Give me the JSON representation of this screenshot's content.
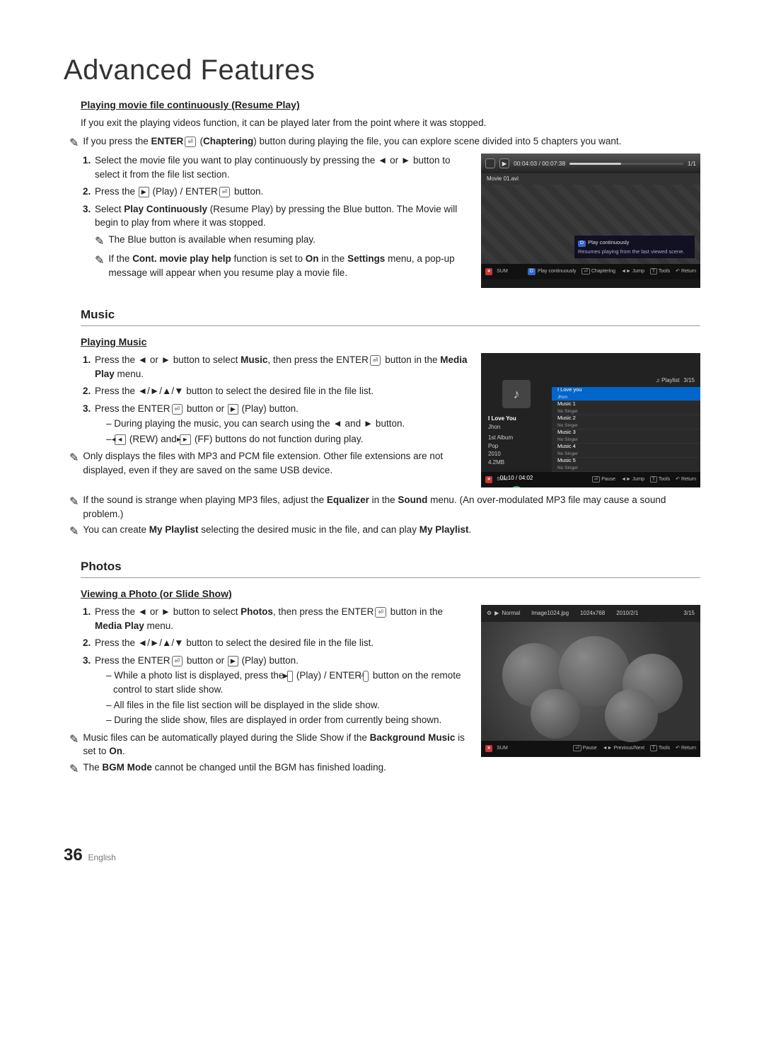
{
  "page": {
    "title": "Advanced Features",
    "number": "36",
    "language": "English"
  },
  "movie_section": {
    "sub_heading": "Playing movie file continuously (Resume Play)",
    "intro": "If you exit the playing videos function, it can be played later from the point where it was stopped.",
    "note_enter_a": "If you press the ",
    "note_enter_b": "ENTER",
    "note_enter_c": " (",
    "note_enter_d": "Chaptering",
    "note_enter_e": ") button during playing the file, you can explore scene divided into 5 chapters you want.",
    "step1": "Select the movie file you want to play continuously by pressing the ◄ or ► button to select it from the file list section.",
    "step2_a": "Press the ",
    "step2_b": " (Play) / ENTER",
    "step2_c": " button.",
    "step3_a": "Select ",
    "step3_b": "Play Continuously",
    "step3_c": " (Resume Play) by pressing the Blue button. The Movie will begin to play from where it was stopped.",
    "note_blue": "The Blue button is available when resuming play.",
    "note_cont_a": "If the ",
    "note_cont_b": "Cont. movie play help",
    "note_cont_c": " function is set to ",
    "note_cont_d": "On",
    "note_cont_e": " in the ",
    "note_cont_f": "Settings",
    "note_cont_g": " menu, a pop-up message will appear when you resume play a movie file."
  },
  "movie_screen": {
    "time": "00:04:03 / 00:07:38",
    "counter": "1/1",
    "filename": "Movie 01.avi",
    "popup_title": "Play continuously",
    "popup_body": "Resumes playing from the last viewed scene.",
    "popup_key": "D",
    "footer_sum": "SUM",
    "footer_play": "Play continuously",
    "footer_chapter": "Chaptering",
    "footer_jump": "Jump",
    "footer_tools": "Tools",
    "footer_return": "Return",
    "footer_key": "D"
  },
  "music_section": {
    "heading": "Music",
    "sub_heading": "Playing Music",
    "step1_a": "Press the ◄ or ► button to select ",
    "step1_b": "Music",
    "step1_c": ", then press the ENTER",
    "step1_d": " button in the ",
    "step1_e": "Media Play",
    "step1_f": " menu.",
    "step2": "Press the ◄/►/▲/▼ button to select the desired file in the file list.",
    "step3_a": "Press the ENTER",
    "step3_b": " button or ",
    "step3_c": " (Play) button.",
    "dash1": "During playing the music, you can search using the ◄ and ► button.",
    "dash2_a": " (REW) and ",
    "dash2_b": " (FF) buttons do not function during play.",
    "note_ext": "Only displays the files with MP3 and PCM file extension. Other file extensions are not displayed, even if they are saved on the same USB device.",
    "note_eq_a": "If the sound is strange when playing MP3 files, adjust the ",
    "note_eq_b": "Equalizer",
    "note_eq_c": " in the ",
    "note_eq_d": "Sound",
    "note_eq_e": " menu. (An over-modulated MP3 file may cause a sound problem.)",
    "note_pl_a": "You can create ",
    "note_pl_b": "My Playlist",
    "note_pl_c": " selecting the desired music in the file, and can play ",
    "note_pl_d": "My Playlist",
    "note_pl_e": "."
  },
  "music_screen": {
    "playlist_label": "Playlist",
    "playlist_count": "3/15",
    "now_title": "I Love You",
    "now_artist": "Jhon",
    "album": "1st Album",
    "genre": "Pop",
    "year": "2010",
    "size": "4.2MB",
    "time": "01:10 / 04:02",
    "items": [
      {
        "t": "I Love you",
        "s": "Jhon"
      },
      {
        "t": "Music 1",
        "s": "No Singer"
      },
      {
        "t": "Music 2",
        "s": "No Singer"
      },
      {
        "t": "Music 3",
        "s": "No Singer"
      },
      {
        "t": "Music 4",
        "s": "No Singer"
      },
      {
        "t": "Music 5",
        "s": "No Singer"
      }
    ],
    "footer_sum": "SUM",
    "footer_pause": "Pause",
    "footer_jump": "Jump",
    "footer_tools": "Tools",
    "footer_return": "Return"
  },
  "photos_section": {
    "heading": "Photos",
    "sub_heading": "Viewing a Photo (or Slide Show)",
    "step1_a": "Press the ◄ or ► button to select ",
    "step1_b": "Photos",
    "step1_c": ", then press the ENTER",
    "step1_d": " button in the ",
    "step1_e": "Media Play",
    "step1_f": " menu.",
    "step2": "Press the ◄/►/▲/▼ button to select the desired file in the file list.",
    "step3_a": "Press the ENTER",
    "step3_b": " button or ",
    "step3_c": " (Play) button.",
    "dash1_a": "While a photo list is displayed, press the ",
    "dash1_b": " (Play) / ENTER",
    "dash1_c": " button on the remote control to start slide show.",
    "dash2": "All files in the file list section will be displayed in the slide show.",
    "dash3": "During the slide show, files are displayed in order from currently being shown.",
    "note_bgm_a": "Music files can be automatically played during the Slide Show if the ",
    "note_bgm_b": "Background Music",
    "note_bgm_c": " is set to ",
    "note_bgm_d": "On",
    "note_bgm_e": ".",
    "note_mode_a": "The ",
    "note_mode_b": "BGM Mode",
    "note_mode_c": " cannot be changed until the BGM has finished loading."
  },
  "photo_screen": {
    "mode": "Normal",
    "filename": "Image1024.jpg",
    "res": "1024x768",
    "date": "2010/2/1",
    "count": "3/15",
    "footer_sum": "SUM",
    "footer_pause": "Pause",
    "footer_prevnext": "Previous/Next",
    "footer_tools": "Tools",
    "footer_return": "Return"
  }
}
